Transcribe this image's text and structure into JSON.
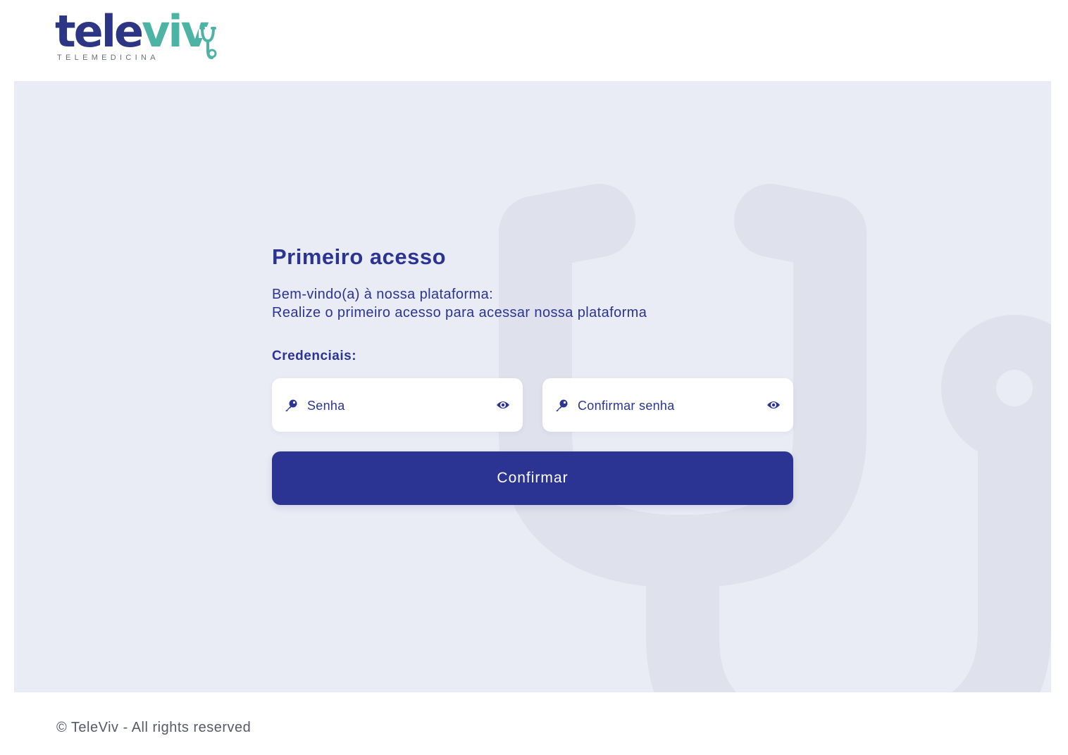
{
  "header": {
    "logo_main_dark": "tele",
    "logo_main_accent": "viv",
    "logo_subtitle": "TELEMEDICINA"
  },
  "form": {
    "title": "Primeiro acesso",
    "subtitle_line1": "Bem-vindo(a) à nossa plataforma:",
    "subtitle_line2": "Realize o primeiro acesso para acessar nossa plataforma",
    "credentials_label": "Credenciais:",
    "password_placeholder": "Senha",
    "password_value": "",
    "confirm_password_placeholder": "Confirmar senha",
    "confirm_password_value": "",
    "submit_label": "Confirmar"
  },
  "footer": {
    "copyright": "© TeleViv - All rights reserved"
  },
  "icons": {
    "password_leading": "key-icon",
    "password_trailing": "eye-icon",
    "confirm_leading": "key-icon",
    "confirm_trailing": "eye-icon"
  },
  "colors": {
    "primary": "#2b3493",
    "accent": "#4db3a4",
    "panel_bg": "#e9ebf5",
    "watermark": "#dfe1ec"
  }
}
